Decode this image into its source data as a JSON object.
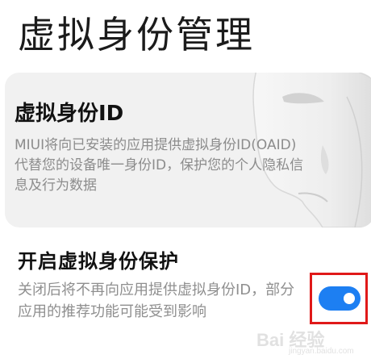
{
  "page": {
    "title": "虚拟身份管理"
  },
  "info_card": {
    "title": "虚拟身份ID",
    "description": "MIUI将向已安装的应用提供虚拟身份ID(OAID)代替您的设备唯一身份ID，保护您的个人隐私信息及行为数据",
    "illustration": "mask-illustration"
  },
  "setting": {
    "title": "开启虚拟身份保护",
    "description": "关闭后将不再向应用提供虚拟身份ID，部分应用的推荐功能可能受到影响",
    "toggle_on": true
  },
  "watermark": {
    "logo_text": "Bai 经验",
    "sub_text": "jingyan.baidu.com"
  },
  "colors": {
    "toggle_on": "#1d7ff2",
    "highlight": "#e01919",
    "card_bg": "#f1f1f1"
  }
}
